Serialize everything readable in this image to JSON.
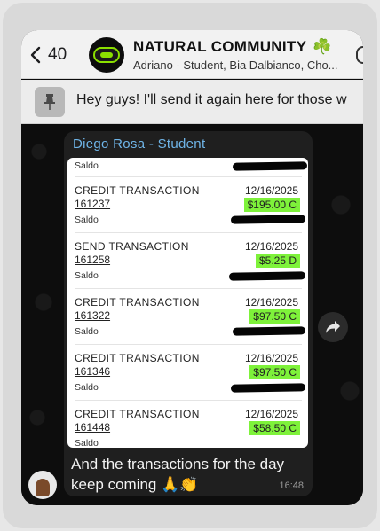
{
  "header": {
    "back_count": "40",
    "title": "NATURAL COMMUNITY",
    "title_emoji": "☘️",
    "subtitle": "Adriano - Student, Bia Dalbianco, Cho..."
  },
  "pinned": {
    "text": "Hey guys! I'll send it again here for those w"
  },
  "message": {
    "sender": "Diego Rosa - Student",
    "top_saldo": "Saldo",
    "transactions": [
      {
        "type": "CREDIT TRANSACTION",
        "id": "161237",
        "date": "12/16/2025",
        "amount": "$195.00 C",
        "saldo": "Saldo"
      },
      {
        "type": "SEND TRANSACTION",
        "id": "161258",
        "date": "12/16/2025",
        "amount": "$5.25 D",
        "saldo": "Saldo"
      },
      {
        "type": "CREDIT TRANSACTION",
        "id": "161322",
        "date": "12/16/2025",
        "amount": "$97.50 C",
        "saldo": "Saldo"
      },
      {
        "type": "CREDIT TRANSACTION",
        "id": "161346",
        "date": "12/16/2025",
        "amount": "$97.50 C",
        "saldo": "Saldo"
      },
      {
        "type": "CREDIT TRANSACTION",
        "id": "161448",
        "date": "12/16/2025",
        "amount": "$58.50 C",
        "saldo": "Saldo"
      }
    ],
    "caption": "And the transactions for the day keep coming 🙏👏",
    "time": "16:48"
  },
  "icons": {
    "back": "chevron-left-icon",
    "pin": "pin-icon",
    "forward": "forward-icon"
  },
  "colors": {
    "highlight": "#7ef23a",
    "sender": "#6fb5e8"
  }
}
